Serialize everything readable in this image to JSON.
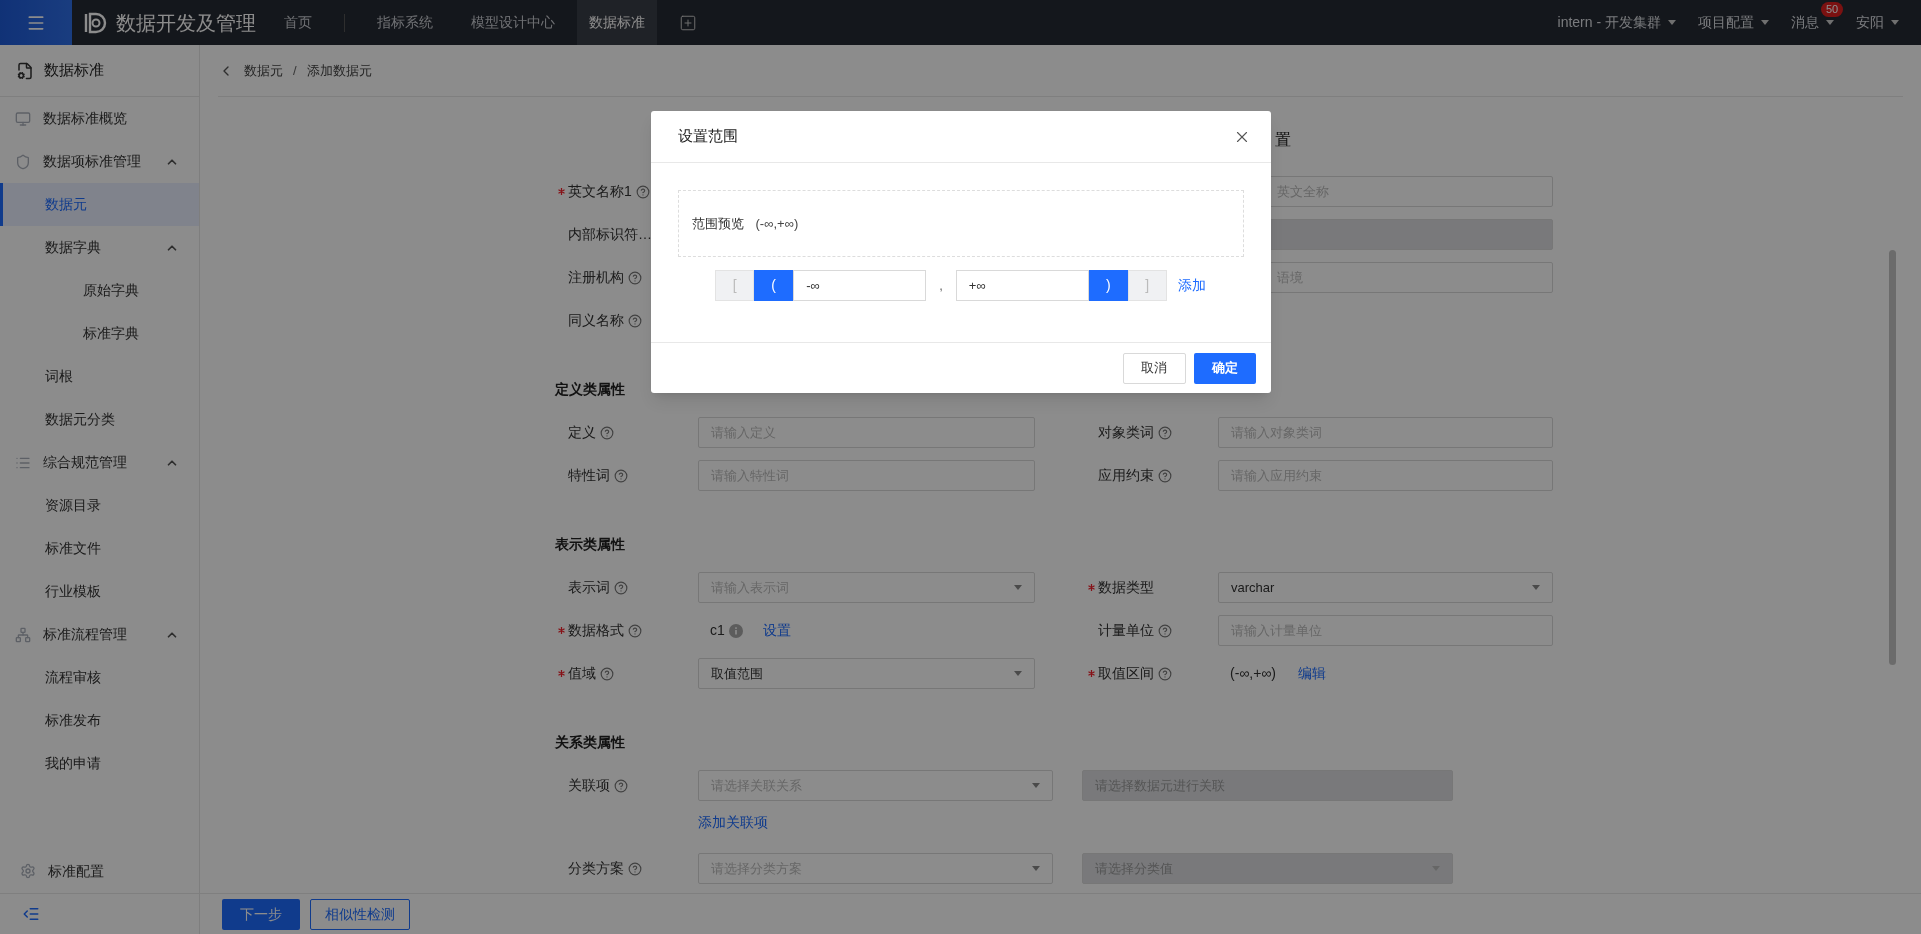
{
  "topbar": {
    "app_title": "数据开发及管理",
    "nav": [
      {
        "label": "首页",
        "selected": false
      },
      {
        "label": "指标系统",
        "selected": false
      },
      {
        "label": "模型设计中心",
        "selected": false
      },
      {
        "label": "数据标准",
        "selected": true
      }
    ],
    "right_menus": [
      {
        "label": "intern - 开发集群"
      },
      {
        "label": "项目配置"
      },
      {
        "label": "消息",
        "badge": "50"
      },
      {
        "label": "安阳"
      }
    ]
  },
  "sidebar": {
    "title": "数据标准",
    "items": [
      {
        "label": "数据标准概览",
        "selected": false
      },
      {
        "label": "数据项标准管理",
        "selected": false,
        "expanded": true,
        "children": [
          {
            "label": "数据元",
            "selected": true
          },
          {
            "label": "数据字典",
            "selected": false,
            "expanded": true,
            "children": [
              {
                "label": "原始字典",
                "selected": false
              },
              {
                "label": "标准字典",
                "selected": false
              }
            ]
          },
          {
            "label": "词根",
            "selected": false
          },
          {
            "label": "数据元分类",
            "selected": false
          }
        ]
      },
      {
        "label": "综合规范管理",
        "selected": false,
        "expanded": true,
        "children": [
          {
            "label": "资源目录",
            "selected": false
          },
          {
            "label": "标准文件",
            "selected": false
          },
          {
            "label": "行业模板",
            "selected": false
          }
        ]
      },
      {
        "label": "标准流程管理",
        "selected": false,
        "expanded": true,
        "children": [
          {
            "label": "流程审核",
            "selected": false
          },
          {
            "label": "标准发布",
            "selected": false
          },
          {
            "label": "我的申请",
            "selected": false
          }
        ]
      }
    ],
    "footer_item": "标准配置"
  },
  "breadcrumb": {
    "items": [
      "数据元",
      "添加数据元"
    ],
    "separator": "/"
  },
  "form": {
    "heading_fragment": "置",
    "top_rows": [
      {
        "label": "英文名称1",
        "required": true,
        "help": true,
        "right_field": {
          "placeholder": "英文全称",
          "disabled": false
        }
      },
      {
        "label": "内部标识符…",
        "required": false,
        "help": false,
        "right_field": {
          "disabled": true
        }
      },
      {
        "label": "注册机构",
        "required": false,
        "help": true,
        "right_field": {
          "placeholder": "语境",
          "disabled": false
        }
      },
      {
        "label": "同义名称",
        "required": false,
        "help": true
      }
    ],
    "sections": [
      {
        "title": "定义类属性",
        "rows": [
          {
            "kind": "fields",
            "fields": [
              {
                "label": "定义",
                "required": false,
                "help": true,
                "control": {
                  "kind": "input",
                  "placeholder": "请输入定义"
                }
              },
              {
                "label": "对象类词",
                "required": false,
                "help": true,
                "control": {
                  "kind": "input",
                  "placeholder": "请输入对象类词"
                }
              }
            ]
          },
          {
            "kind": "fields",
            "fields": [
              {
                "label": "特性词",
                "required": false,
                "help": true,
                "control": {
                  "kind": "input",
                  "placeholder": "请输入特性词"
                }
              },
              {
                "label": "应用约束",
                "required": false,
                "help": true,
                "control": {
                  "kind": "input",
                  "placeholder": "请输入应用约束"
                }
              }
            ]
          }
        ]
      },
      {
        "title": "表示类属性",
        "rows": [
          {
            "kind": "fields",
            "fields": [
              {
                "label": "表示词",
                "required": false,
                "help": true,
                "control": {
                  "kind": "select",
                  "placeholder": "请输入表示词"
                }
              },
              {
                "label": "数据类型",
                "required": true,
                "help": false,
                "control": {
                  "kind": "select",
                  "value": "varchar"
                }
              }
            ]
          },
          {
            "kind": "fields",
            "fields": [
              {
                "label": "数据格式",
                "required": true,
                "help": true,
                "control": {
                  "kind": "text",
                  "value": "c1",
                  "info": true,
                  "link": "设置"
                }
              },
              {
                "label": "计量单位",
                "required": false,
                "help": true,
                "control": {
                  "kind": "input",
                  "placeholder": "请输入计量单位"
                }
              }
            ]
          },
          {
            "kind": "fields",
            "fields": [
              {
                "label": "值域",
                "required": true,
                "help": true,
                "control": {
                  "kind": "select",
                  "value": "取值范围"
                }
              },
              {
                "label": "取值区间",
                "required": true,
                "help": true,
                "control": {
                  "kind": "text",
                  "value": "(-∞,+∞)",
                  "info": false,
                  "link": "编辑"
                }
              }
            ]
          }
        ]
      },
      {
        "title": "关系类属性",
        "rows": [
          {
            "kind": "wide",
            "label": "关联项",
            "required": false,
            "help": true,
            "controls": [
              {
                "kind": "select",
                "placeholder": "请选择关联关系",
                "disabled": false
              },
              {
                "kind": "input",
                "placeholder": "请选择数据元进行关联",
                "disabled": true
              }
            ]
          },
          {
            "kind": "link",
            "link": "添加关联项"
          },
          {
            "kind": "wide",
            "label": "分类方案",
            "required": false,
            "help": true,
            "controls": [
              {
                "kind": "select",
                "placeholder": "请选择分类方案",
                "disabled": false
              },
              {
                "kind": "select",
                "placeholder": "请选择分类值",
                "disabled": true
              }
            ]
          }
        ]
      }
    ]
  },
  "bottom_buttons": [
    {
      "label": "下一步",
      "kind": "primary"
    },
    {
      "label": "相似性检测",
      "kind": "outline"
    }
  ],
  "dialog": {
    "title": "设置范围",
    "preview_label": "范围预览",
    "preview_value": "(-∞,+∞)",
    "lower": {
      "brackets": [
        {
          "label": "[",
          "selected": false
        },
        {
          "label": "(",
          "selected": true
        }
      ],
      "value": "-∞"
    },
    "separator": ",",
    "upper": {
      "value": "+∞",
      "brackets": [
        {
          "label": ")",
          "selected": true
        },
        {
          "label": "]",
          "selected": false
        }
      ]
    },
    "add_link": "添加",
    "buttons": [
      {
        "label": "取消",
        "kind": "default"
      },
      {
        "label": "确定",
        "kind": "primary"
      }
    ]
  }
}
